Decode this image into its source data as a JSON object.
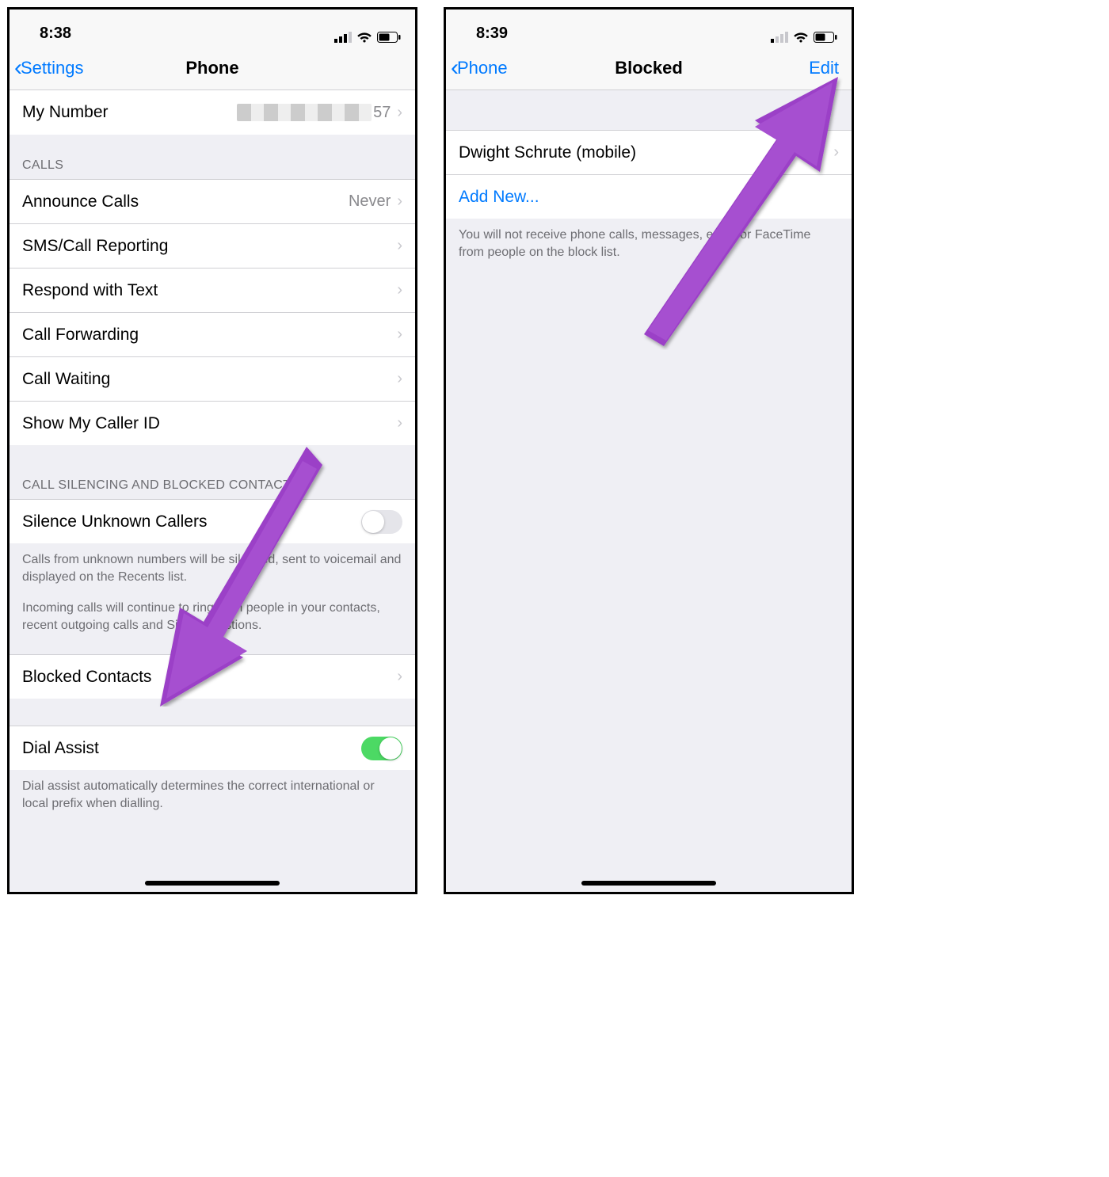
{
  "left": {
    "statusbar": {
      "time": "8:38"
    },
    "nav": {
      "back": "Settings",
      "title": "Phone"
    },
    "my_number": {
      "label": "My Number",
      "suffix": "57"
    },
    "calls_header": "CALLS",
    "calls": {
      "announce": {
        "label": "Announce Calls",
        "value": "Never"
      },
      "sms_report": {
        "label": "SMS/Call Reporting"
      },
      "respond": {
        "label": "Respond with Text"
      },
      "forward": {
        "label": "Call Forwarding"
      },
      "waiting": {
        "label": "Call Waiting"
      },
      "caller_id": {
        "label": "Show My Caller ID"
      }
    },
    "silence_header": "CALL SILENCING AND BLOCKED CONTACTS",
    "silence": {
      "label": "Silence Unknown Callers"
    },
    "silence_footer1": "Calls from unknown numbers will be silenced, sent to voicemail and displayed on the Recents list.",
    "silence_footer2": "Incoming calls will continue to ring from people in your contacts, recent outgoing calls and Siri Suggestions.",
    "blocked": {
      "label": "Blocked Contacts"
    },
    "dial_assist": {
      "label": "Dial Assist"
    },
    "dial_assist_footer": "Dial assist automatically determines the correct international or local prefix when dialling."
  },
  "right": {
    "statusbar": {
      "time": "8:39"
    },
    "nav": {
      "back": "Phone",
      "title": "Blocked",
      "action": "Edit"
    },
    "entry": {
      "label": "Dwight Schrute (mobile)"
    },
    "add_new": "Add New...",
    "footer": "You will not receive phone calls, messages, email or FaceTime from people on the block list."
  }
}
